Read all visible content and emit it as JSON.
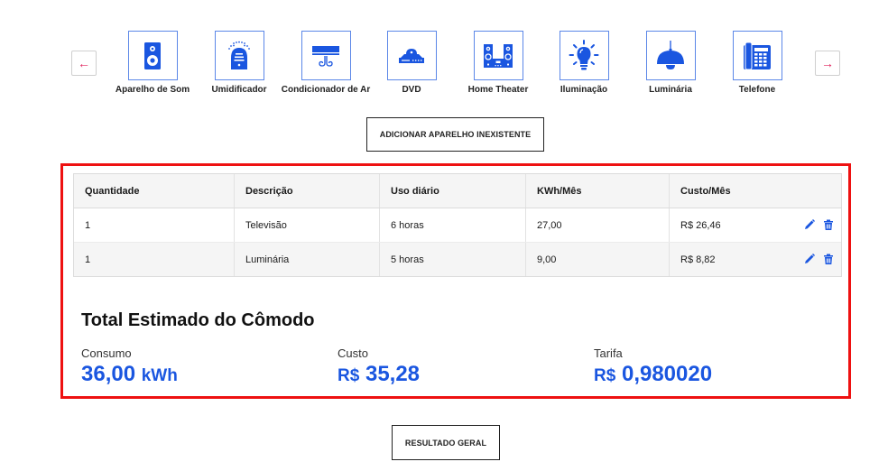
{
  "carousel": {
    "prev_icon": "arrow-left-icon",
    "next_icon": "arrow-right-icon",
    "prev_glyph": "←",
    "next_glyph": "→",
    "devices": [
      {
        "label": "Aparelho de Som",
        "icon": "speaker-icon"
      },
      {
        "label": "Umidificador",
        "icon": "humidifier-icon"
      },
      {
        "label": "Condicionador de Ar",
        "icon": "air-conditioner-icon"
      },
      {
        "label": "DVD",
        "icon": "dvd-player-icon"
      },
      {
        "label": "Home Theater",
        "icon": "home-theater-icon"
      },
      {
        "label": "Iluminação",
        "icon": "lightbulb-icon"
      },
      {
        "label": "Luminária",
        "icon": "pendant-lamp-icon"
      },
      {
        "label": "Telefone",
        "icon": "telephone-icon"
      }
    ]
  },
  "add_button_label": "ADICIONAR APARELHO INEXISTENTE",
  "table": {
    "headers": [
      "Quantidade",
      "Descrição",
      "Uso diário",
      "KWh/Mês",
      "Custo/Mês"
    ],
    "rows": [
      {
        "quantidade": "1",
        "descricao": "Televisão",
        "uso": "6 horas",
        "kwh": "27,00",
        "custo": "R$ 26,46"
      },
      {
        "quantidade": "1",
        "descricao": "Luminária",
        "uso": "5 horas",
        "kwh": "9,00",
        "custo": "R$ 8,82"
      }
    ],
    "row_actions": [
      "edit-pencil-icon",
      "delete-trash-icon"
    ]
  },
  "totals": {
    "title": "Total Estimado do Cômodo",
    "consumo": {
      "label": "Consumo",
      "value": "36,00",
      "unit": "kWh"
    },
    "custo": {
      "label": "Custo",
      "prefix": "R$",
      "value": "35,28"
    },
    "tarifa": {
      "label": "Tarifa",
      "prefix": "R$",
      "value": "0,980020"
    }
  },
  "result_button_label": "RESULTADO GERAL",
  "colors": {
    "accent_blue": "#1a56e0",
    "highlight_red": "#ee1111",
    "arrow_pink": "#e0245e"
  }
}
